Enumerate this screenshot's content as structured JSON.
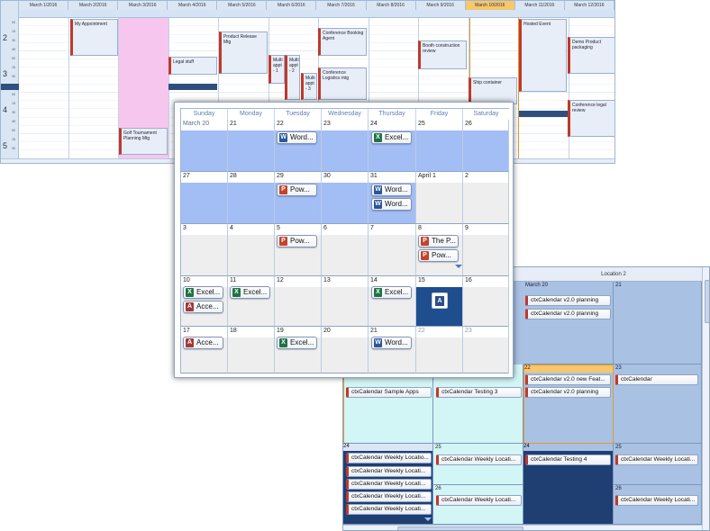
{
  "dayview": {
    "dates": [
      "March 1/2016",
      "March 2/2016",
      "March 3/2016",
      "March 4/2016",
      "March 5/2016",
      "March 6/2016",
      "March 7/2016",
      "March 8/2016",
      "March 9/2016",
      "March 10/2016",
      "March 11/2016",
      "March 12/2016"
    ],
    "today_index": 9,
    "hours": [
      "2",
      "3",
      "4",
      "5"
    ],
    "minute_marks": [
      "00",
      "15",
      "30",
      "45"
    ],
    "appointments": [
      "My Appointment",
      "Product Release Mtg",
      "Conference Booking Agent",
      "Booth construction review",
      "Hosted Event",
      "Demo Product packaging",
      "Legal stuff",
      "Multi appt - 1",
      "Multi appt - 2",
      "Multi appt - 3",
      "Conference Logistics mtg",
      "Ship container",
      "Conference legal review",
      "Golf Tournament Planning Mtg"
    ]
  },
  "monthview": {
    "days_of_week": [
      "Sunday",
      "Monday",
      "Tuesday",
      "Wednesday",
      "Thursday",
      "Friday",
      "Saturday"
    ],
    "weeks": [
      [
        "March 20",
        "21",
        "22",
        "23",
        "24",
        "25",
        "26"
      ],
      [
        "27",
        "28",
        "29",
        "30",
        "31",
        "April 1",
        "2"
      ],
      [
        "3",
        "4",
        "5",
        "6",
        "7",
        "8",
        "9"
      ],
      [
        "10",
        "11",
        "12",
        "13",
        "14",
        "15",
        "16"
      ],
      [
        "17",
        "18",
        "19",
        "20",
        "21",
        "22",
        "23"
      ]
    ],
    "chips": {
      "w0_tue": "Word...",
      "w0_thu": "Excel...",
      "w1_tue": "Pow...",
      "w1_thu_a": "Word...",
      "w1_thu_b": "Word...",
      "w2_tue": "Pow...",
      "w2_fri_a": "The P...",
      "w2_fri_b": "Pow...",
      "w3_sun_a": "Excel...",
      "w3_sun_b": "Acce...",
      "w3_mon": "Excel...",
      "w3_thu": "Excel...",
      "w4_sun": "Acce...",
      "w4_tue": "Excel...",
      "w4_thu": "Word..."
    },
    "colors": {
      "blue_row": "#a3bdf5",
      "grey_cell": "#eeeeee",
      "selected": "#1f4e8f"
    }
  },
  "locview": {
    "location_title": "Location 2",
    "dates": {
      "d_top_left": "March 20",
      "d_top_right": "21",
      "d22": "22",
      "d23": "23",
      "d24a": "24",
      "d25a": "25",
      "d24b": "24",
      "d25b": "25",
      "d26a": "26",
      "d26b": "26"
    },
    "appointments": {
      "p1": "ctxCalendar v2.0 planning",
      "p2": "ctxCalendar v2.0 planning",
      "nf": "ctxCalendar v2.0 new Feat...",
      "p3": "ctxCalendar v2.0 planning",
      "cc": "ctxCalendar",
      "sa": "ctxCalendar Sample Apps",
      "t3": "ctxCalendar Testing 3",
      "t4": "ctxCalendar Testing 4",
      "w1": "ctxCalendar Weekly Locatio...",
      "w2": "ctxCalendar Weekly Locati...",
      "w3": "ctxCalendar Weekly Locati...",
      "w4": "ctxCalendar Weekly Locati...",
      "w5": "ctxCalendar Weekly Locati...",
      "w6": "ctxCalendar Weekly Locati...",
      "w7": "ctxCalendar Weekly Locati...",
      "w8": "ctxCalendar Weekly Locati...",
      "w9": "ctxCalendar Weekly Locati..."
    }
  }
}
